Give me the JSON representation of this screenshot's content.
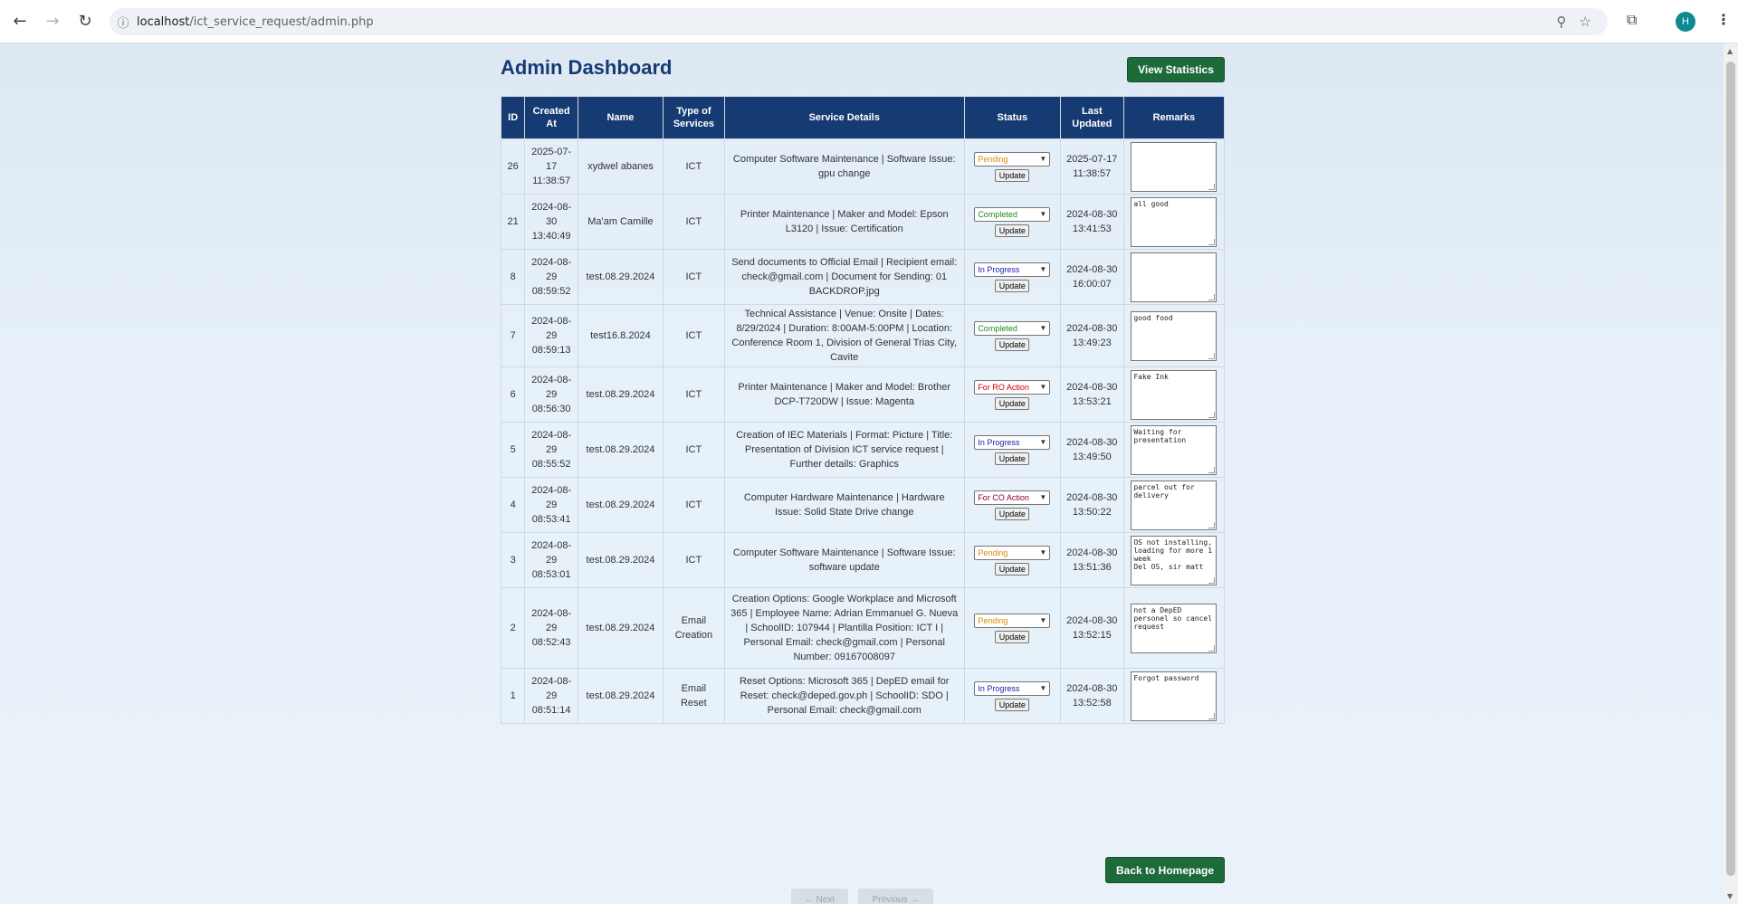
{
  "browser": {
    "url_host": "localhost",
    "url_path": "/ict_service_request/admin.php",
    "avatar_letter": "H"
  },
  "page": {
    "title": "Admin Dashboard",
    "view_stats_label": "View Statistics",
    "back_home_label": "Back to Homepage",
    "next_label": "← Next",
    "prev_label": "Previous →"
  },
  "table": {
    "headers": [
      "ID",
      "Created At",
      "Name",
      "Type of Services",
      "Service Details",
      "Status",
      "Last Updated",
      "Remarks"
    ],
    "update_label": "Update",
    "status_colors": {
      "Pending": "#e08a00",
      "Completed": "#1e8a1e",
      "In Progress": "#1a1ab0",
      "For RO Action": "#d10000",
      "For CO Action": "#8a0030"
    },
    "rows": [
      {
        "id": "26",
        "created": "2025-07-17 11:38:57",
        "name": "xydwel abanes",
        "type": "ICT",
        "details": "Computer Software Maintenance | Software Issue: gpu change",
        "status": "Pending",
        "updated": "2025-07-17 11:38:57",
        "remarks": "",
        "h": 61
      },
      {
        "id": "21",
        "created": "2024-08-30 13:40:49",
        "name": "Ma'am Camille",
        "type": "ICT",
        "details": "Printer Maintenance | Maker and Model: Epson L3120 | Issue: Certification",
        "status": "Completed",
        "updated": "2024-08-30 13:41:53",
        "remarks": "all good",
        "h": 61
      },
      {
        "id": "8",
        "created": "2024-08-29 08:59:52",
        "name": "test.08.29.2024",
        "type": "ICT",
        "details": "Send documents to Official Email | Recipient email: check@gmail.com | Document for Sending: 01 BACKDROP.jpg",
        "status": "In Progress",
        "updated": "2024-08-30 16:00:07",
        "remarks": "",
        "h": 61
      },
      {
        "id": "7",
        "created": "2024-08-29 08:59:13",
        "name": "test16.8.2024",
        "type": "ICT",
        "details": "Technical Assistance | Venue: Onsite | Dates: 8/29/2024 | Duration: 8:00AM-5:00PM | Location: Conference Room 1, Division of General Trias City, Cavite",
        "status": "Completed",
        "updated": "2024-08-30 13:49:23",
        "remarks": "good food",
        "h": 63
      },
      {
        "id": "6",
        "created": "2024-08-29 08:56:30",
        "name": "test.08.29.2024",
        "type": "ICT",
        "details": "Printer Maintenance | Maker and Model: Brother DCP-T720DW | Issue: Magenta",
        "status": "For RO Action",
        "updated": "2024-08-30 13:53:21",
        "remarks": "Fake Ink",
        "h": 61
      },
      {
        "id": "5",
        "created": "2024-08-29 08:55:52",
        "name": "test.08.29.2024",
        "type": "ICT",
        "details": "Creation of IEC Materials | Format: Picture | Title: Presentation of Division ICT service request | Further details: Graphics",
        "status": "In Progress",
        "updated": "2024-08-30 13:49:50",
        "remarks": "Waiting for\npresentation",
        "h": 61
      },
      {
        "id": "4",
        "created": "2024-08-29 08:53:41",
        "name": "test.08.29.2024",
        "type": "ICT",
        "details": "Computer Hardware Maintenance | Hardware Issue: Solid State Drive change",
        "status": "For CO Action",
        "updated": "2024-08-30 13:50:22",
        "remarks": "parcel out for\ndelivery",
        "h": 61
      },
      {
        "id": "3",
        "created": "2024-08-29 08:53:01",
        "name": "test.08.29.2024",
        "type": "ICT",
        "details": "Computer Software Maintenance | Software Issue: software update",
        "status": "Pending",
        "updated": "2024-08-30 13:51:36",
        "remarks": "OS not installing, loading for more 1 week\nDel OS, sir matt",
        "h": 61
      },
      {
        "id": "2",
        "created": "2024-08-29 08:52:43",
        "name": "test.08.29.2024",
        "type": "Email Creation",
        "details": "Creation Options: Google Workplace and Microsoft 365 | Employee Name: Adrian Emmanuel G. Nueva | SchoolID: 107944 | Plantilla Position: ICT I | Personal Email: check@gmail.com | Personal Number: 09167008097",
        "status": "Pending",
        "updated": "2024-08-30 13:52:15",
        "remarks": "not a DepED personel so cancel request",
        "h": 89
      },
      {
        "id": "1",
        "created": "2024-08-29 08:51:14",
        "name": "test.08.29.2024",
        "type": "Email Reset",
        "details": "Reset Options: Microsoft 365 | DepED email for Reset: check@deped.gov.ph | SchoolID: SDO | Personal Email: check@gmail.com",
        "status": "In Progress",
        "updated": "2024-08-30 13:52:58",
        "remarks": "Forgot password",
        "h": 61
      }
    ]
  }
}
